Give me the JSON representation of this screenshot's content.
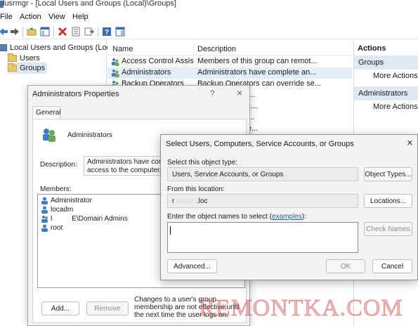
{
  "window": {
    "title": "lusrmgr - [Local Users and Groups (Local)\\Groups]"
  },
  "menu": [
    "File",
    "Action",
    "View",
    "Help"
  ],
  "tree": {
    "root": "Local Users and Groups (Local)",
    "items": [
      "Users",
      "Groups"
    ]
  },
  "list": {
    "columns": [
      "Name",
      "Description"
    ],
    "rows": [
      {
        "name": "Access Control Assist...",
        "desc": "Members of this group can remot..."
      },
      {
        "name": "Administrators",
        "desc": "Administrators have complete an..."
      },
      {
        "name": "Backup Operators",
        "desc": "Backup Operators can override se..."
      },
      {
        "name": "",
        "desc": "orized to perfor..."
      },
      {
        "name": "",
        "desc": "roup can chang..."
      },
      {
        "name": "",
        "desc": "ed to launch, a..."
      },
      {
        "name": "",
        "desc": "roup can read e..."
      }
    ]
  },
  "actions": {
    "header": "Actions",
    "sections": [
      {
        "title": "Groups",
        "items": [
          "More Actions"
        ]
      },
      {
        "title": "Administrators",
        "items": [
          "More Actions"
        ]
      }
    ]
  },
  "props_dialog": {
    "title": "Administrators Properties",
    "help": "?",
    "close": "×",
    "tab": "General",
    "group_name": "Administrators",
    "description_label": "Description:",
    "description_value": "Administrators have complete and unrestricted access to the computer/domain",
    "members_label": "Members:",
    "members": [
      "Administrator",
      "locadm",
      "l",
      "root"
    ],
    "member_domain_admins": "E\\Domain Admins",
    "add_button": "Add...",
    "remove_button": "Remove",
    "note": "Changes to a user's group membership are not effective until the next time the user logs on."
  },
  "select_dialog": {
    "title": "Select Users, Computers, Service Accounts, or Groups",
    "close": "×",
    "object_type_label": "Select this object type:",
    "object_type_value": "Users, Service Accounts, or Groups",
    "object_types_button": "Object Types...",
    "location_label": "From this location:",
    "location_prefix": "r",
    "location_value": ".loc",
    "locations_button": "Locations...",
    "names_label": "Enter the object names to select (",
    "names_link": "examples",
    "names_label_end": "):",
    "check_names_button": "Check Names",
    "advanced_button": "Advanced...",
    "ok_button": "OK",
    "cancel_button": "Cancel"
  },
  "watermark": "REMONTKA.COM"
}
